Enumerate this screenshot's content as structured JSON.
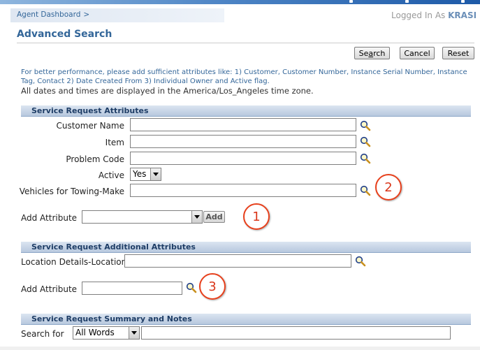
{
  "header": {
    "breadcrumb": "Agent Dashboard",
    "breadcrumb_separator": ">",
    "logged_in_prefix": "Logged In As",
    "logged_in_user": "KRASI"
  },
  "page": {
    "title": "Advanced Search",
    "instructions": "For better performance, please add sufficient attributes like: 1) Customer, Customer Number, Instance Serial Number, Instance Tag, Contact 2) Date Created From 3) Individual Owner and Active flag.",
    "timezone_note": "All dates and times are displayed in the America/Los_Angeles time zone."
  },
  "buttons": {
    "search": "Search",
    "cancel": "Cancel",
    "reset": "Reset"
  },
  "sections": {
    "attributes": {
      "title": "Service Request Attributes",
      "fields": {
        "customer_name": {
          "label": "Customer Name",
          "value": ""
        },
        "item": {
          "label": "Item",
          "value": ""
        },
        "problem_code": {
          "label": "Problem Code",
          "value": ""
        },
        "active": {
          "label": "Active",
          "value": "Yes"
        },
        "vehicles": {
          "label": "Vehicles for Towing-Make",
          "value": ""
        }
      },
      "add_attribute": {
        "label": "Add Attribute",
        "value": "",
        "button": "Add"
      }
    },
    "additional": {
      "title": "Service Request Additional Attributes",
      "location": {
        "label": "Location Details-Location",
        "value": ""
      },
      "add_attribute": {
        "label": "Add Attribute",
        "value": ""
      }
    },
    "summary": {
      "title": "Service Request Summary and Notes",
      "search_for": {
        "label": "Search for",
        "mode": "All Words",
        "value": ""
      }
    }
  },
  "callouts": [
    "1",
    "2",
    "3"
  ],
  "colors": {
    "link": "#336699",
    "section_header": "#b7c8de",
    "callout": "#e8401c"
  }
}
